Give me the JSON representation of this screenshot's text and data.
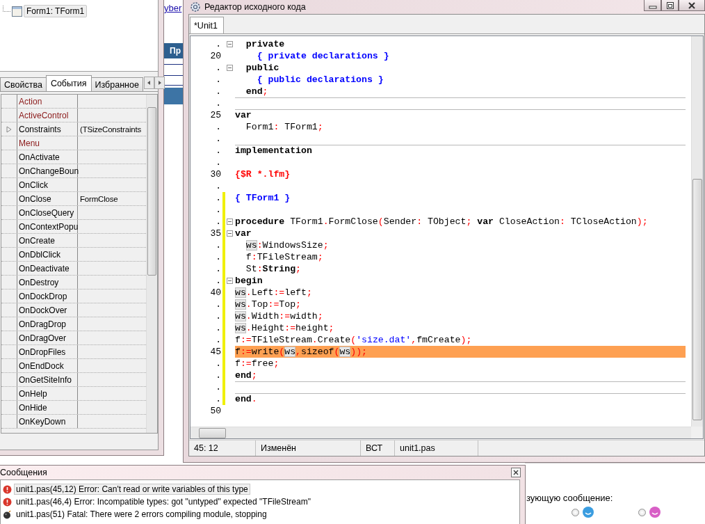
{
  "backdrop": {
    "link": "yber",
    "bar_label": "Пр",
    "prompt": "зующую сообщение:",
    "radios": [
      {
        "selected": false
      },
      {
        "selected": false
      }
    ]
  },
  "inspector": {
    "tree": [
      {
        "label": "Form1: TForm1",
        "selected": true
      }
    ],
    "tabs": [
      {
        "label": "Свойства",
        "selected": false
      },
      {
        "label": "События",
        "selected": true
      },
      {
        "label": "Избранное",
        "selected": false
      }
    ],
    "rows": [
      {
        "name": "Action",
        "kind": "reference",
        "expandable": false
      },
      {
        "name": "ActiveControl",
        "kind": "reference",
        "expandable": false
      },
      {
        "name": "Constraints",
        "value": "(TSizeConstraints",
        "kind": "plain",
        "expandable": true
      },
      {
        "name": "Menu",
        "kind": "reference",
        "expandable": false
      },
      {
        "name": "OnActivate",
        "kind": "plain",
        "expandable": false
      },
      {
        "name": "OnChangeBoun",
        "kind": "plain",
        "expandable": false
      },
      {
        "name": "OnClick",
        "kind": "plain",
        "expandable": false
      },
      {
        "name": "OnClose",
        "value": "FormClose",
        "kind": "plain",
        "expandable": false
      },
      {
        "name": "OnCloseQuery",
        "kind": "plain",
        "expandable": false
      },
      {
        "name": "OnContextPopu",
        "kind": "plain",
        "expandable": false
      },
      {
        "name": "OnCreate",
        "kind": "plain",
        "expandable": false
      },
      {
        "name": "OnDblClick",
        "kind": "plain",
        "expandable": false
      },
      {
        "name": "OnDeactivate",
        "kind": "plain",
        "expandable": false
      },
      {
        "name": "OnDestroy",
        "kind": "plain",
        "expandable": false
      },
      {
        "name": "OnDockDrop",
        "kind": "plain",
        "expandable": false
      },
      {
        "name": "OnDockOver",
        "kind": "plain",
        "expandable": false
      },
      {
        "name": "OnDragDrop",
        "kind": "plain",
        "expandable": false
      },
      {
        "name": "OnDragOver",
        "kind": "plain",
        "expandable": false
      },
      {
        "name": "OnDropFiles",
        "kind": "plain",
        "expandable": false
      },
      {
        "name": "OnEndDock",
        "kind": "plain",
        "expandable": false
      },
      {
        "name": "OnGetSiteInfo",
        "kind": "plain",
        "expandable": false
      },
      {
        "name": "OnHelp",
        "kind": "plain",
        "expandable": false
      },
      {
        "name": "OnHide",
        "kind": "plain",
        "expandable": false
      },
      {
        "name": "OnKeyDown",
        "kind": "plain",
        "expandable": false
      }
    ]
  },
  "editor": {
    "title": "Редактор исходного кода",
    "tabs": [
      {
        "label": "*Unit1",
        "selected": true
      }
    ],
    "lines": [
      {
        "number": ".",
        "modified": false,
        "fold": true,
        "highlighted": false,
        "divider_above": false,
        "tokens": [
          {
            "text": "  private",
            "kind": "keyword"
          }
        ]
      },
      {
        "number": "20",
        "modified": false,
        "fold": false,
        "highlighted": false,
        "divider_above": false,
        "tokens": [
          {
            "text": "    { private declarations }",
            "kind": "comment"
          }
        ]
      },
      {
        "number": ".",
        "modified": false,
        "fold": true,
        "highlighted": false,
        "divider_above": false,
        "tokens": [
          {
            "text": "  public",
            "kind": "keyword"
          }
        ]
      },
      {
        "number": ".",
        "modified": false,
        "fold": false,
        "highlighted": false,
        "divider_above": false,
        "tokens": [
          {
            "text": "    { public declarations }",
            "kind": "comment"
          }
        ]
      },
      {
        "number": ".",
        "modified": false,
        "fold": false,
        "highlighted": false,
        "divider_above": false,
        "tokens": [
          {
            "text": "  end",
            "kind": "keyword"
          },
          {
            "text": ";",
            "kind": "symbol"
          }
        ]
      },
      {
        "number": ".",
        "modified": false,
        "fold": false,
        "highlighted": false,
        "divider_above": true
      },
      {
        "number": "25",
        "modified": false,
        "fold": false,
        "highlighted": false,
        "divider_above": true,
        "tokens": [
          {
            "text": "var",
            "kind": "keyword"
          }
        ]
      },
      {
        "number": ".",
        "modified": false,
        "fold": false,
        "highlighted": false,
        "divider_above": false,
        "tokens": [
          {
            "text": "  Form1",
            "kind": "identifier"
          },
          {
            "text": ":",
            "kind": "symbol"
          },
          {
            "text": " TForm1",
            "kind": "identifier"
          },
          {
            "text": ";",
            "kind": "symbol"
          }
        ]
      },
      {
        "number": ".",
        "modified": false,
        "fold": false,
        "highlighted": false,
        "divider_above": false
      },
      {
        "number": ".",
        "modified": false,
        "fold": false,
        "highlighted": false,
        "divider_above": true,
        "tokens": [
          {
            "text": "implementation",
            "kind": "keyword"
          }
        ]
      },
      {
        "number": ".",
        "modified": false,
        "fold": false,
        "highlighted": false,
        "divider_above": false
      },
      {
        "number": "30",
        "modified": false,
        "fold": false,
        "highlighted": false,
        "divider_above": false,
        "tokens": [
          {
            "text": "{$R *.lfm}",
            "kind": "directive"
          }
        ]
      },
      {
        "number": ".",
        "modified": false,
        "fold": false,
        "highlighted": false,
        "divider_above": false
      },
      {
        "number": ".",
        "modified": true,
        "fold": false,
        "highlighted": false,
        "divider_above": false,
        "tokens": [
          {
            "text": "{ TForm1 }",
            "kind": "comment"
          }
        ]
      },
      {
        "number": ".",
        "modified": true,
        "fold": false,
        "highlighted": false,
        "divider_above": false
      },
      {
        "number": ".",
        "modified": true,
        "fold": true,
        "highlighted": false,
        "divider_above": false,
        "tokens": [
          {
            "text": "procedure",
            "kind": "keyword"
          },
          {
            "text": " TForm1",
            "kind": "identifier"
          },
          {
            "text": ".",
            "kind": "symbol"
          },
          {
            "text": "FormClose",
            "kind": "identifier"
          },
          {
            "text": "(",
            "kind": "symbol"
          },
          {
            "text": "Sender",
            "kind": "identifier"
          },
          {
            "text": ":",
            "kind": "symbol"
          },
          {
            "text": " TObject",
            "kind": "identifier"
          },
          {
            "text": ";",
            "kind": "symbol"
          },
          {
            "text": " var",
            "kind": "keyword"
          },
          {
            "text": " CloseAction",
            "kind": "identifier"
          },
          {
            "text": ":",
            "kind": "symbol"
          },
          {
            "text": " TCloseAction",
            "kind": "identifier"
          },
          {
            "text": ");",
            "kind": "symbol"
          }
        ]
      },
      {
        "number": "35",
        "modified": true,
        "fold": true,
        "highlighted": false,
        "divider_above": false,
        "tokens": [
          {
            "text": "var",
            "kind": "keyword"
          }
        ]
      },
      {
        "number": ".",
        "modified": true,
        "fold": false,
        "highlighted": false,
        "divider_above": false,
        "tokens": [
          {
            "text": "  ws",
            "kind": "highlight"
          },
          {
            "text": ":",
            "kind": "symbol"
          },
          {
            "text": "WindowsSize",
            "kind": "identifier"
          },
          {
            "text": ";",
            "kind": "symbol"
          }
        ]
      },
      {
        "number": ".",
        "modified": true,
        "fold": false,
        "highlighted": false,
        "divider_above": false,
        "tokens": [
          {
            "text": "  f",
            "kind": "identifier"
          },
          {
            "text": ":",
            "kind": "symbol"
          },
          {
            "text": "TFileStream",
            "kind": "identifier"
          },
          {
            "text": ";",
            "kind": "symbol"
          }
        ]
      },
      {
        "number": ".",
        "modified": true,
        "fold": false,
        "highlighted": false,
        "divider_above": false,
        "tokens": [
          {
            "text": "  St",
            "kind": "identifier"
          },
          {
            "text": ":",
            "kind": "symbol"
          },
          {
            "text": "String",
            "kind": "keyword"
          },
          {
            "text": ";",
            "kind": "symbol"
          }
        ]
      },
      {
        "number": ".",
        "modified": true,
        "fold": true,
        "highlighted": false,
        "divider_above": false,
        "tokens": [
          {
            "text": "begin",
            "kind": "keyword"
          }
        ]
      },
      {
        "number": "40",
        "modified": true,
        "fold": false,
        "highlighted": false,
        "divider_above": false,
        "tokens": [
          {
            "text": "ws",
            "kind": "highlight"
          },
          {
            "text": ".",
            "kind": "symbol"
          },
          {
            "text": "Left",
            "kind": "identifier"
          },
          {
            "text": ":=",
            "kind": "symbol"
          },
          {
            "text": "left",
            "kind": "identifier"
          },
          {
            "text": ";",
            "kind": "symbol"
          }
        ]
      },
      {
        "number": ".",
        "modified": true,
        "fold": false,
        "highlighted": false,
        "divider_above": false,
        "tokens": [
          {
            "text": "ws",
            "kind": "highlight"
          },
          {
            "text": ".",
            "kind": "symbol"
          },
          {
            "text": "Top",
            "kind": "identifier"
          },
          {
            "text": ":=",
            "kind": "symbol"
          },
          {
            "text": "Top",
            "kind": "identifier"
          },
          {
            "text": ";",
            "kind": "symbol"
          }
        ]
      },
      {
        "number": ".",
        "modified": true,
        "fold": false,
        "highlighted": false,
        "divider_above": false,
        "tokens": [
          {
            "text": "ws",
            "kind": "highlight"
          },
          {
            "text": ".",
            "kind": "symbol"
          },
          {
            "text": "Width",
            "kind": "identifier"
          },
          {
            "text": ":=",
            "kind": "symbol"
          },
          {
            "text": "width",
            "kind": "identifier"
          },
          {
            "text": ";",
            "kind": "symbol"
          }
        ]
      },
      {
        "number": ".",
        "modified": true,
        "fold": false,
        "highlighted": false,
        "divider_above": false,
        "tokens": [
          {
            "text": "ws",
            "kind": "highlight"
          },
          {
            "text": ".",
            "kind": "symbol"
          },
          {
            "text": "Height",
            "kind": "identifier"
          },
          {
            "text": ":=",
            "kind": "symbol"
          },
          {
            "text": "height",
            "kind": "identifier"
          },
          {
            "text": ";",
            "kind": "symbol"
          }
        ]
      },
      {
        "number": ".",
        "modified": true,
        "fold": false,
        "highlighted": false,
        "divider_above": false,
        "tokens": [
          {
            "text": "f",
            "kind": "identifier"
          },
          {
            "text": ":=",
            "kind": "symbol"
          },
          {
            "text": "TFileStream",
            "kind": "identifier"
          },
          {
            "text": ".",
            "kind": "symbol"
          },
          {
            "text": "Create",
            "kind": "identifier"
          },
          {
            "text": "(",
            "kind": "symbol"
          },
          {
            "text": "'size.dat'",
            "kind": "string"
          },
          {
            "text": ",",
            "kind": "symbol"
          },
          {
            "text": "fmCreate",
            "kind": "identifier"
          },
          {
            "text": ");",
            "kind": "symbol"
          }
        ]
      },
      {
        "number": "45",
        "modified": true,
        "fold": false,
        "highlighted": true,
        "divider_above": false,
        "tokens": [
          {
            "text": "f",
            "kind": "identifier"
          },
          {
            "text": ":=",
            "kind": "symbol"
          },
          {
            "text": "write",
            "kind": "identifier"
          },
          {
            "text": "(",
            "kind": "symbol"
          },
          {
            "text": "ws",
            "kind": "highlight"
          },
          {
            "text": ",",
            "kind": "symbol"
          },
          {
            "text": "sizeof",
            "kind": "identifier"
          },
          {
            "text": "(",
            "kind": "symbol"
          },
          {
            "text": "ws",
            "kind": "highlight"
          },
          {
            "text": "));",
            "kind": "symbol"
          }
        ]
      },
      {
        "number": ".",
        "modified": true,
        "fold": false,
        "highlighted": false,
        "divider_above": false,
        "tokens": [
          {
            "text": "f",
            "kind": "identifier"
          },
          {
            "text": ":=",
            "kind": "symbol"
          },
          {
            "text": "free",
            "kind": "identifier"
          },
          {
            "text": ";",
            "kind": "symbol"
          }
        ]
      },
      {
        "number": ".",
        "modified": true,
        "fold": false,
        "highlighted": false,
        "divider_above": false,
        "tokens": [
          {
            "text": "end",
            "kind": "keyword"
          },
          {
            "text": ";",
            "kind": "symbol"
          }
        ]
      },
      {
        "number": ".",
        "modified": true,
        "fold": false,
        "highlighted": false,
        "divider_above": true
      },
      {
        "number": ".",
        "modified": true,
        "fold": false,
        "highlighted": false,
        "divider_above": true,
        "tokens": [
          {
            "text": "end",
            "kind": "keyword"
          },
          {
            "text": ".",
            "kind": "symbol"
          }
        ]
      },
      {
        "number": "50",
        "modified": false,
        "fold": false,
        "highlighted": false,
        "divider_above": false
      }
    ],
    "status_bar": [
      "45: 12",
      "Изменён",
      "ВСТ",
      "unit1.pas"
    ]
  },
  "messages": {
    "title": "Сообщения",
    "items": [
      {
        "text": "unit1.pas(45,12) Error: Can't read or write variables of this type",
        "kind": "error",
        "selected": true
      },
      {
        "text": "unit1.pas(46,4) Error: Incompatible types: got \"untyped\" expected \"TFileStream\"",
        "kind": "error",
        "selected": false
      },
      {
        "text": "unit1.pas(51) Fatal: There were 2 errors compiling module, stopping",
        "kind": "fatal",
        "selected": false
      }
    ]
  }
}
